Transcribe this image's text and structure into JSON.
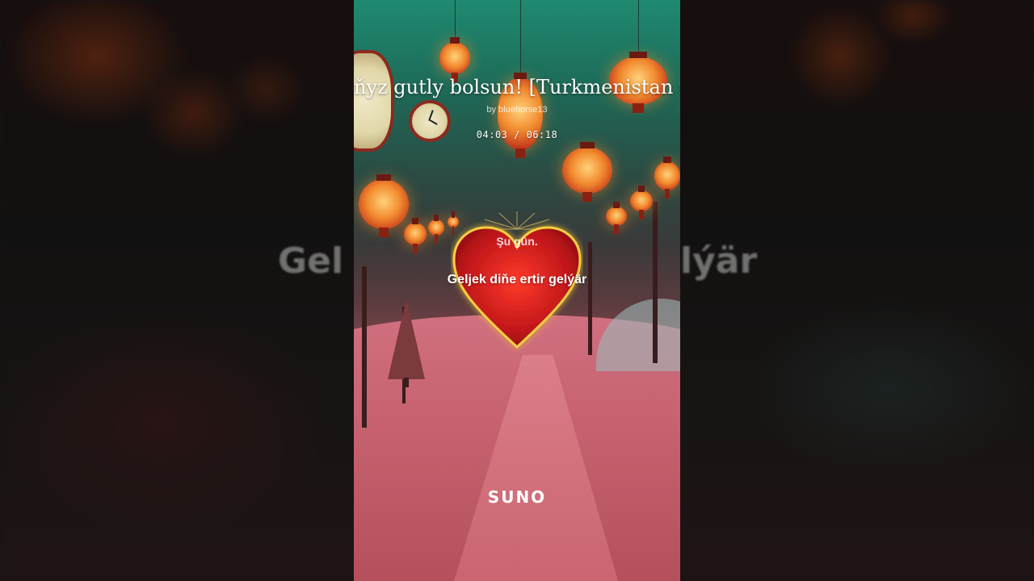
{
  "video": {
    "title": "ňyz gutly bolsun! [Turkmenistan romanti",
    "byline": "by bluehorse13",
    "time_display": "04:03 / 06:18",
    "brand": "SUNO"
  },
  "lyrics": {
    "previous": "Şu gün.",
    "current": "Geljek diňe ertir gelýär"
  },
  "backdrop": {
    "left_text": "Gel",
    "right_text": "lýär"
  },
  "colors": {
    "heart": "#c0161a",
    "heart_glow": "#f5d040",
    "sky_top": "#1f8a70",
    "ground": "#c76270"
  },
  "icons": {
    "heart": "heart-icon",
    "clock": "clock-icon",
    "lantern": "lantern-icon"
  }
}
